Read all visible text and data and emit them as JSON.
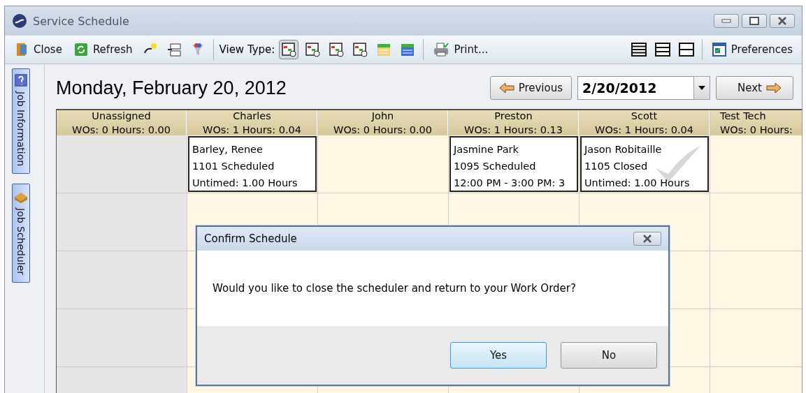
{
  "window": {
    "title": "Service Schedule"
  },
  "toolbar": {
    "items": [
      {
        "kind": "button",
        "label": "Close"
      },
      {
        "kind": "button",
        "label": "Refresh"
      },
      {
        "kind": "icon"
      },
      {
        "kind": "icon"
      },
      {
        "kind": "icon"
      }
    ],
    "view_type_label": "View Type:",
    "view_types": [
      {
        "selected": true
      },
      {
        "selected": false
      },
      {
        "selected": false
      },
      {
        "selected": false
      },
      {
        "selected": false
      },
      {
        "selected": false
      }
    ],
    "print": {
      "label": "Print..."
    },
    "preferences": {
      "label": "Preferences"
    }
  },
  "side_tabs": [
    {
      "label": "Job Information"
    },
    {
      "label": "Job Scheduler"
    }
  ],
  "date_heading": "Monday, February 20, 2012",
  "nav": {
    "previous": "Previous",
    "date": "2/20/2012",
    "next": "Next"
  },
  "schedule": {
    "columns": [
      {
        "name": "Unassigned",
        "summary": "WOs: 0 Hours: 0.00",
        "unassigned": true
      },
      {
        "name": "Charles",
        "summary": "WOs: 1 Hours: 0.04",
        "unassigned": false,
        "appointments": [
          {
            "lines": [
              "Barley, Renee",
              "1101 Scheduled",
              "Untimed: 1.00 Hours"
            ],
            "kind": "open"
          }
        ]
      },
      {
        "name": "John",
        "summary": "WOs: 0 Hours: 0.00",
        "unassigned": false
      },
      {
        "name": "Preston",
        "summary": "WOs: 1 Hours: 0.13",
        "unassigned": false,
        "appointments": [
          {
            "lines": [
              "Jasmine Park",
              "1095 Scheduled",
              "12:00 PM - 3:00 PM: 3"
            ],
            "kind": "open"
          }
        ]
      },
      {
        "name": "Scott",
        "summary": "WOs: 1 Hours: 0.04",
        "unassigned": false,
        "appointments": [
          {
            "lines": [
              "Jason Robitaille",
              "1105 Closed",
              "Untimed: 1.00 Hours"
            ],
            "kind": "closed"
          }
        ]
      },
      {
        "name": "Test Tech",
        "summary": "WOs: 0 Hours:",
        "unassigned": false
      }
    ]
  },
  "dialog": {
    "title": "Confirm Schedule",
    "message": "Would you like to close the scheduler and return to your Work Order?",
    "buttons": [
      {
        "label": "Yes",
        "selected": true
      },
      {
        "label": "No",
        "selected": false
      }
    ]
  }
}
